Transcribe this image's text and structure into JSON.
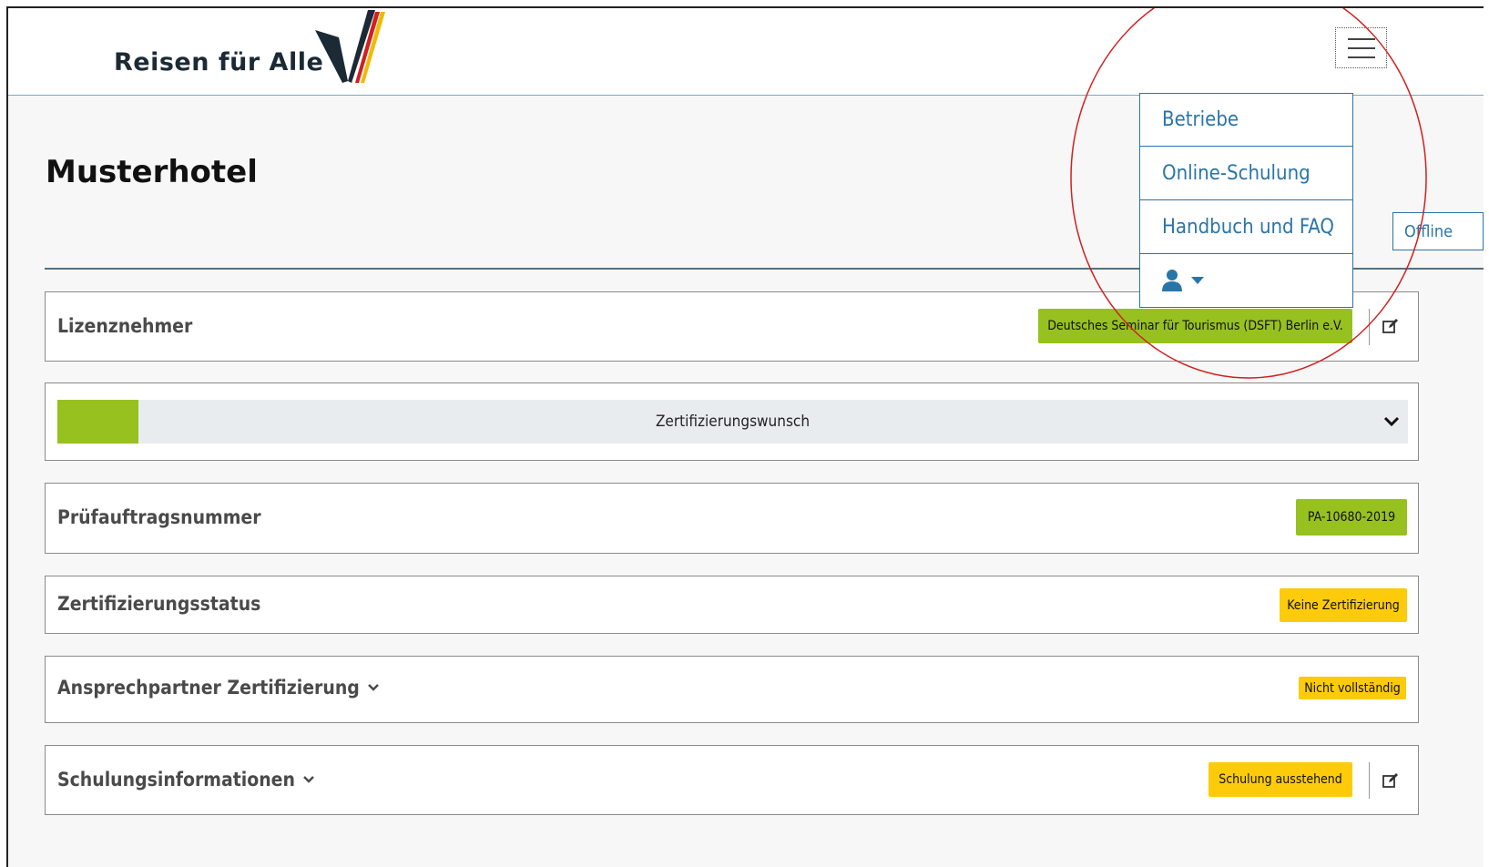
{
  "header": {
    "logo_text": "Reisen für Alle",
    "menu_toggle_icon": "hamburger-icon"
  },
  "page": {
    "title": "Musterhotel",
    "offline_button": "Offline"
  },
  "nav_menu": {
    "items": [
      {
        "label": "Betriebe"
      },
      {
        "label": "Online-Schulung"
      },
      {
        "label": "Handbuch und FAQ"
      }
    ],
    "user_icon": "user-icon",
    "user_caret_icon": "caret-down-icon"
  },
  "cards": {
    "lizenznehmer": {
      "title": "Lizenznehmer",
      "badge": "Deutsches Seminar für Tourismus (DSFT) Berlin e.V.",
      "edit_icon": "edit-icon"
    },
    "zertifizierungswunsch": {
      "label": "Zertifizierungswunsch",
      "progress_percent": 6
    },
    "pruefauftrag": {
      "title": "Prüfauftragsnummer",
      "badge": "PA-10680-2019"
    },
    "status": {
      "title": "Zertifizierungsstatus",
      "badge": "Keine Zertifizierung"
    },
    "ansprechpartner": {
      "title": "Ansprechpartner Zertifizierung",
      "badge": "Nicht vollständig"
    },
    "schulung": {
      "title": "Schulungsinformationen",
      "badge": "Schulung ausstehend",
      "edit_icon": "edit-icon"
    }
  },
  "colors": {
    "accent_blue": "#2a75a8",
    "badge_green": "#97c11f",
    "badge_yellow": "#fdcb09",
    "highlight_circle": "#d21f1f"
  }
}
